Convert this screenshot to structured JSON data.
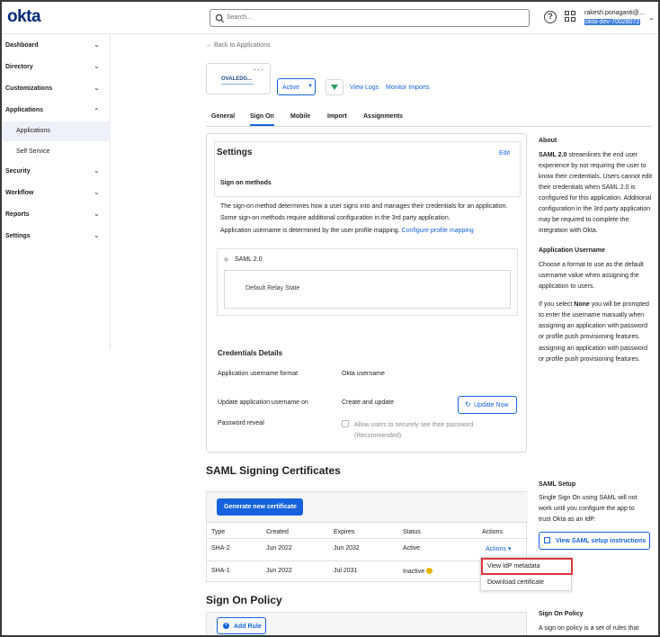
{
  "header": {
    "logo": "okta",
    "search_placeholder": "Search...",
    "user_name": "rakesh.ponaganti@...",
    "user_org": "okta-dev-70028072"
  },
  "sidebar": {
    "items": [
      {
        "label": "Dashboard"
      },
      {
        "label": "Directory"
      },
      {
        "label": "Customizations"
      },
      {
        "label": "Applications"
      },
      {
        "label": "Security"
      },
      {
        "label": "Workflow"
      },
      {
        "label": "Reports"
      },
      {
        "label": "Settings"
      }
    ],
    "sub_items": [
      {
        "label": "Applications"
      },
      {
        "label": "Self Service"
      }
    ]
  },
  "app": {
    "back_label": "← Back to Applications",
    "logo_text": "OVALEDG...",
    "status": "Active",
    "view_logs": "View Logs",
    "monitor_imports": "Monitor Imports"
  },
  "tabs": [
    "General",
    "Sign On",
    "Mobile",
    "Import",
    "Assignments"
  ],
  "settings": {
    "title": "Settings",
    "edit": "Edit",
    "methods_title": "Sign on methods",
    "methods_desc": "The sign-on method determines how a user signs into and manages their credentials for an application. Some sign-on methods require additional configuration in the 3rd party application.",
    "username_desc": "Application username is determined by the user profile mapping.",
    "configure_link": "Configure profile mapping",
    "method_saml": "SAML 2.0",
    "relay_label": "Default Relay State",
    "cred_title": "Credentials Details",
    "rows": [
      {
        "label": "Application username format",
        "value": "Okta username"
      },
      {
        "label": "Update application username on",
        "value": "Create and update"
      },
      {
        "label": "Password reveal",
        "value": ""
      }
    ],
    "update_now": "Update Now",
    "password_reveal_text": "Allow users to securely see their password (Recommended)"
  },
  "about": {
    "title": "About",
    "saml_bold": "SAML 2.0",
    "saml_text": " streamlines the end user experience by not requiring the user to know their credentials. Users cannot edit their credentials when SAML 2.0 is configured for this application. Additional configuration in the 3rd party application may be required to complete the integration with Okta.",
    "username_title": "Application Username",
    "username_text": "Choose a format to use as the default username value when assigning the application to users.",
    "none_pre": "If you select ",
    "none_bold": "None",
    "none_text": " you will be prompted to enter the username manually when assigning an application with password or profile push provisioning features.",
    "extra_text": "assigning an application with password or profile push provisioning features."
  },
  "certs": {
    "title": "SAML Signing Certificates",
    "generate": "Generate new certificate",
    "headers": [
      "Type",
      "Created",
      "Expires",
      "Status",
      "Actions"
    ],
    "rows": [
      {
        "type": "SHA-2",
        "created": "Jun 2022",
        "expires": "Jun 2032",
        "status": "Active",
        "action": "Actions ▾"
      },
      {
        "type": "SHA-1",
        "created": "Jun 2022",
        "expires": "Jul 2031",
        "status": "Inactive",
        "action": ""
      }
    ],
    "menu": [
      "View IdP metadata",
      "Download certificate"
    ]
  },
  "saml_setup": {
    "title": "SAML Setup",
    "text": "Single Sign On using SAML will not work until you configure the app to trust Okta as an IdP.",
    "button": "View SAML setup instructions"
  },
  "policy": {
    "title": "Sign On Policy",
    "add_rule": "Add Rule",
    "side_title": "Sign On Policy",
    "side_text": "A sign on policy is a set of rules that"
  }
}
